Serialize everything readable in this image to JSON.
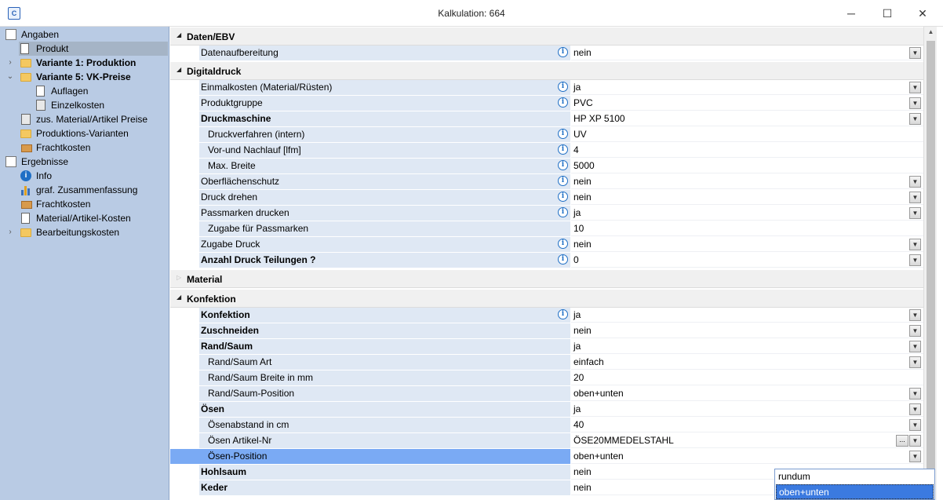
{
  "window": {
    "title": "Kalkulation: 664",
    "app_icon_text": "C",
    "minimize": "─",
    "maximize": "☐",
    "close": "✕"
  },
  "sidebar": {
    "items": [
      {
        "label": "Angaben",
        "icon": "pages-icon",
        "bold": false
      },
      {
        "label": "Produkt",
        "icon": "document-icon",
        "bold": false,
        "selected": true
      },
      {
        "label": "Variante 1: Produktion",
        "icon": "folder-icon",
        "bold": true,
        "chevron": "›"
      },
      {
        "label": "Variante 5: VK-Preise",
        "icon": "folder-icon",
        "bold": true,
        "chevron": "⌄"
      },
      {
        "label": "Auflagen",
        "icon": "document-icon",
        "bold": false
      },
      {
        "label": "Einzelkosten",
        "icon": "calculator-icon",
        "bold": false
      },
      {
        "label": "zus. Material/Artikel Preise",
        "icon": "calculator-icon",
        "bold": false
      },
      {
        "label": "Produktions-Varianten",
        "icon": "folder-icon",
        "bold": false
      },
      {
        "label": "Frachtkosten",
        "icon": "box-icon",
        "bold": false
      },
      {
        "label": "Ergebnisse",
        "icon": "pages-icon",
        "bold": false
      },
      {
        "label": "Info",
        "icon": "info-icon",
        "bold": false
      },
      {
        "label": "graf. Zusammenfassung",
        "icon": "chart-icon",
        "bold": false
      },
      {
        "label": "Frachtkosten",
        "icon": "box-icon",
        "bold": false
      },
      {
        "label": "Material/Artikel-Kosten",
        "icon": "document-icon",
        "bold": false
      },
      {
        "label": "Bearbeitungskosten",
        "icon": "folder-icon",
        "bold": false,
        "chevron": "›"
      }
    ]
  },
  "sections": {
    "daten": {
      "label": "Daten/EBV",
      "toggle": "◢"
    },
    "digital": {
      "label": "Digitaldruck",
      "toggle": "◢"
    },
    "material": {
      "label": "Material",
      "toggle": "▷"
    },
    "konfektion": {
      "label": "Konfektion",
      "toggle": "◢"
    }
  },
  "rows": {
    "datenaufbereitung": {
      "label": "Datenaufbereitung",
      "value": "nein"
    },
    "einmalkosten": {
      "label": "Einmalkosten (Material/Rüsten)",
      "value": "ja"
    },
    "produktgruppe": {
      "label": "Produktgruppe",
      "value": "PVC"
    },
    "druckmaschine": {
      "label": "Druckmaschine",
      "value": "HP XP 5100"
    },
    "druckverfahren": {
      "label": "Druckverfahren (intern)",
      "value": "UV"
    },
    "vornachlauf": {
      "label": "Vor-und Nachlauf [lfm]",
      "value": "4"
    },
    "maxbreite": {
      "label": "Max. Breite",
      "value": "5000"
    },
    "oberflaechenschutz": {
      "label": "Oberflächenschutz",
      "value": "nein"
    },
    "druckdrehen": {
      "label": "Druck drehen",
      "value": "nein"
    },
    "passmarken": {
      "label": "Passmarken drucken",
      "value": "ja"
    },
    "zugabepassmarken": {
      "label": "Zugabe für Passmarken",
      "value": "10"
    },
    "zugabedruck": {
      "label": "Zugabe Druck",
      "value": "nein"
    },
    "anzahlteilungen": {
      "label": "Anzahl Druck Teilungen ?",
      "value": "0"
    },
    "konfektion": {
      "label": "Konfektion",
      "value": "ja"
    },
    "zuschneiden": {
      "label": "Zuschneiden",
      "value": "nein"
    },
    "randsaum": {
      "label": "Rand/Saum",
      "value": "ja"
    },
    "randsaumart": {
      "label": "Rand/Saum Art",
      "value": "einfach"
    },
    "randsaumbreite": {
      "label": "Rand/Saum Breite in mm",
      "value": "20"
    },
    "randsaumposition": {
      "label": "Rand/Saum-Position",
      "value": "oben+unten"
    },
    "oesen": {
      "label": "Ösen",
      "value": "ja"
    },
    "oesenabstand": {
      "label": "Ösenabstand in cm",
      "value": "40"
    },
    "oesenartikel": {
      "label": "Ösen Artikel-Nr",
      "value": "ÖSE20MMEDELSTAHL"
    },
    "oesenposition": {
      "label": "Ösen-Position",
      "value": "oben+unten"
    },
    "hohlsaum": {
      "label": "Hohlsaum",
      "value": "nein"
    },
    "keder": {
      "label": "Keder",
      "value": "nein"
    }
  },
  "icons": {
    "info": "i",
    "dropdown": "▼",
    "ellipsis": "..."
  },
  "popup": {
    "options": [
      "rundum",
      "oben+unten"
    ],
    "selected": "oben+unten"
  }
}
